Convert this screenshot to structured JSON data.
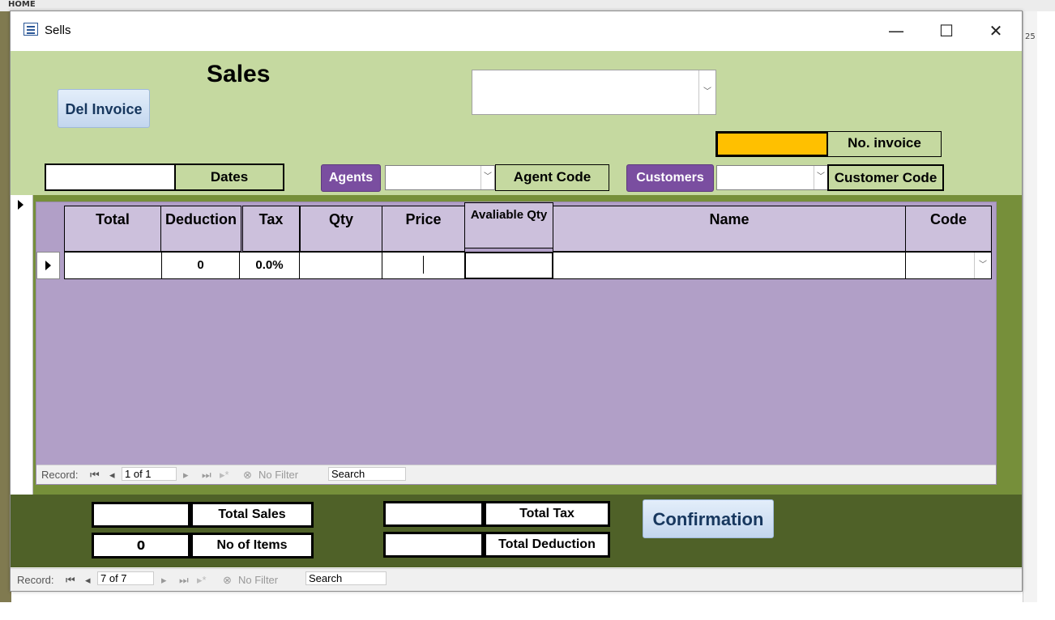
{
  "background": {
    "ribbon_tab": "HOME",
    "right_number": "25"
  },
  "window": {
    "title": "Sells",
    "minimize": "—",
    "maximize": "☐",
    "close": "✕"
  },
  "header": {
    "title": "Sales",
    "del_invoice_button": "Del Invoice",
    "top_combo_value": "",
    "invoice_no_label": "No. invoice",
    "invoice_no_value": "",
    "dates_label": "Dates",
    "dates_value": "",
    "agents_button": "Agents",
    "agent_combo_value": "",
    "agent_code_label": "Agent Code",
    "customers_button": "Customers",
    "customer_combo_value": "",
    "customer_code_label": "Customer Code"
  },
  "grid": {
    "columns": [
      "Total",
      "Deduction",
      "Tax",
      "Qty",
      "Price",
      "Avaliable Qty",
      "Name",
      "Code"
    ],
    "row": {
      "total": "",
      "deduction": "0",
      "tax": "0.0%",
      "qty": "",
      "price": "",
      "available_qty": "",
      "name": "",
      "code": ""
    },
    "nav": {
      "record_label": "Record:",
      "position": "1 of 1",
      "filter": "No Filter",
      "search": "Search"
    }
  },
  "footer": {
    "total_sales_label": "Total Sales",
    "total_sales_value": "",
    "items_label": "No of Items",
    "items_value": "0",
    "total_tax_label": "Total Tax",
    "total_tax_value": "",
    "total_deduction_label": "Total Deduction",
    "total_deduction_value": "",
    "confirm_button": "Confirmation"
  },
  "main_nav": {
    "record_label": "Record:",
    "position": "7 of 7",
    "filter": "No Filter",
    "search": "Search"
  },
  "colors": {
    "header_bg": "#c5d9a0",
    "detail_bg": "#768f3a",
    "footer_bg": "#4f6128",
    "subform_bg": "#b19fc7",
    "invoice_highlight": "#ffc000",
    "purple_button": "#7a4ea0"
  },
  "icons": [
    "form-icon",
    "dropdown-arrow-icon",
    "record-selector-icon",
    "first-record-icon",
    "prev-record-icon",
    "next-record-icon",
    "last-record-icon",
    "new-record-icon",
    "filter-icon"
  ]
}
